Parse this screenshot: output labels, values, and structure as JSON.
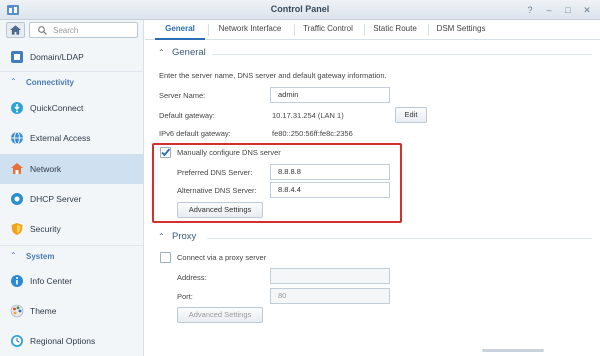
{
  "window": {
    "title": "Control Panel",
    "controls": [
      "?",
      "–",
      "□",
      "✕"
    ]
  },
  "sidebar": {
    "search_placeholder": "Search",
    "items": [
      {
        "label": "Domain/LDAP",
        "icon": "domain-icon"
      },
      {
        "label": "QuickConnect",
        "icon": "quickconnect-icon"
      },
      {
        "label": "External Access",
        "icon": "globe-icon"
      },
      {
        "label": "Network",
        "icon": "network-icon"
      },
      {
        "label": "DHCP Server",
        "icon": "dhcp-icon"
      },
      {
        "label": "Security",
        "icon": "shield-icon"
      },
      {
        "label": "Info Center",
        "icon": "info-icon"
      },
      {
        "label": "Theme",
        "icon": "theme-icon"
      },
      {
        "label": "Regional Options",
        "icon": "clock-icon"
      }
    ],
    "sections": {
      "connectivity": "Connectivity",
      "system": "System"
    },
    "active": "Network"
  },
  "tabs": [
    "General",
    "Network Interface",
    "Traffic Control",
    "Static Route",
    "DSM Settings"
  ],
  "general": {
    "header": "General",
    "description": "Enter the server name, DNS server and default gateway information.",
    "server_name_label": "Server Name:",
    "server_name_value": "admin",
    "default_gateway_label": "Default gateway:",
    "default_gateway_value": "10.17.31.254 (LAN 1)",
    "edit_button": "Edit",
    "ipv6_label": "IPv6 default gateway:",
    "ipv6_value": "fe80::250:56ff:fe8c:2356",
    "dns_checkbox_label": "Manually configure DNS server",
    "dns_checked": true,
    "preferred_dns_label": "Preferred DNS Server:",
    "preferred_dns_value": "8.8.8.8",
    "alternative_dns_label": "Alternative DNS Server:",
    "alternative_dns_value": "8.8.4.4",
    "advanced_button": "Advanced Settings"
  },
  "proxy": {
    "header": "Proxy",
    "checkbox_label": "Connect via a proxy server",
    "checked": false,
    "address_label": "Address:",
    "address_value": "",
    "port_label": "Port:",
    "port_value": "80",
    "advanced_button": "Advanced Settings"
  },
  "colors": {
    "accent": "#2b6cb5",
    "highlight": "#d32f2f",
    "section": "#4a7ab3"
  }
}
